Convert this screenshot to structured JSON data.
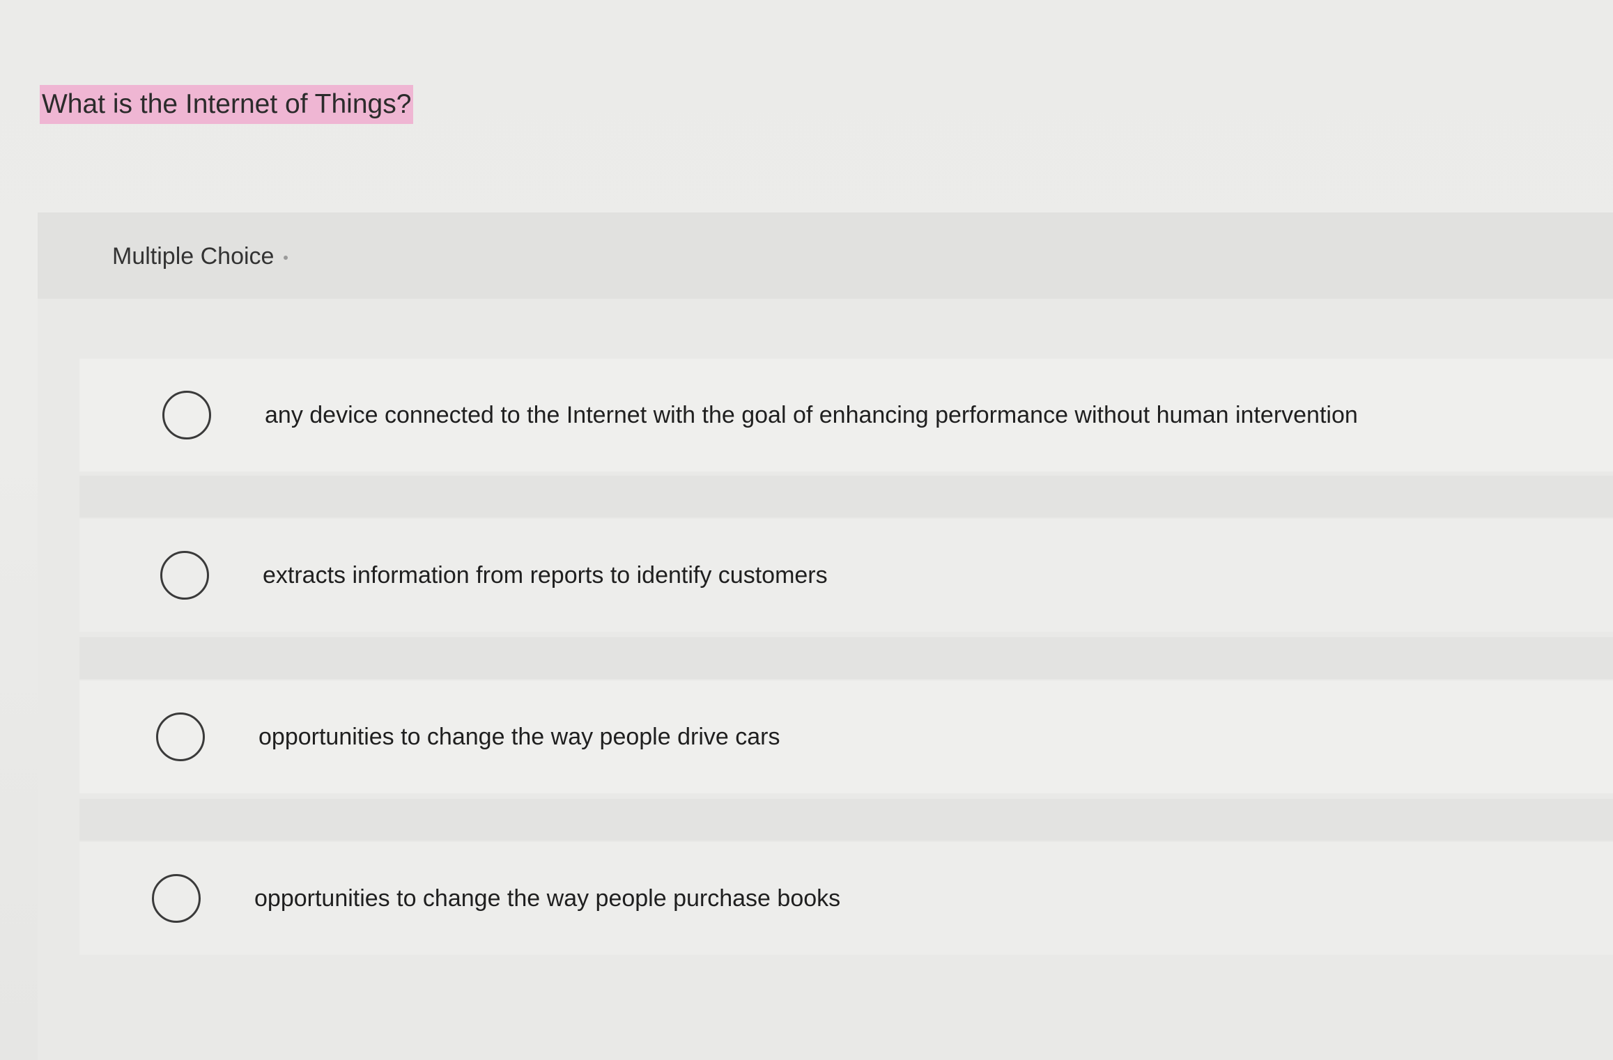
{
  "question": {
    "text": "What is the Internet of Things?",
    "highlight_color": "#efb6d3"
  },
  "panel": {
    "type_label": "Multiple Choice"
  },
  "options": [
    {
      "label": "any device connected to the Internet with the goal of enhancing performance without human intervention",
      "selected": false
    },
    {
      "label": "extracts information from reports to identify customers",
      "selected": false
    },
    {
      "label": "opportunities to change the way people drive cars",
      "selected": false
    },
    {
      "label": "opportunities to change the way people purchase books",
      "selected": false
    }
  ]
}
